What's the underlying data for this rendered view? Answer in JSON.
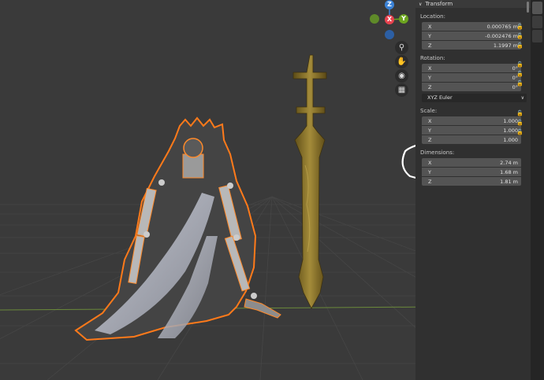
{
  "panel": {
    "title": "Transform",
    "location": {
      "label": "Location:",
      "rows": [
        {
          "axis": "X",
          "value": "0.000765 m"
        },
        {
          "axis": "Y",
          "value": "-0.002476 m"
        },
        {
          "axis": "Z",
          "value": "1.1997 m"
        }
      ]
    },
    "rotation": {
      "label": "Rotation:",
      "rows": [
        {
          "axis": "X",
          "value": "0°"
        },
        {
          "axis": "Y",
          "value": "0°"
        },
        {
          "axis": "Z",
          "value": "0°"
        }
      ],
      "mode": "XYZ Euler"
    },
    "scale": {
      "label": "Scale:",
      "rows": [
        {
          "axis": "X",
          "value": "1.000"
        },
        {
          "axis": "Y",
          "value": "1.000"
        },
        {
          "axis": "Z",
          "value": "1.000"
        }
      ]
    },
    "dimensions": {
      "label": "Dimensions:",
      "rows": [
        {
          "axis": "X",
          "value": "2.74 m"
        },
        {
          "axis": "Y",
          "value": "1.68 m"
        },
        {
          "axis": "Z",
          "value": "1.81 m"
        }
      ]
    }
  },
  "gizmo": {
    "z_label": "Z",
    "x_label": "X",
    "y_label": "Y",
    "colors": {
      "x": "#e8434f",
      "y": "#6ca51f",
      "z": "#3b82d6"
    }
  },
  "nav_icons": [
    "zoom-icon",
    "hand-pan-icon",
    "camera-icon",
    "grid-icon"
  ],
  "colors": {
    "viewport_bg": "#3a3a3a",
    "panel_bg": "#303030",
    "field_bg": "#545454",
    "selection_outline": "#ff7a1a",
    "sword": "#8a7628",
    "annotation": "#ffffff"
  }
}
